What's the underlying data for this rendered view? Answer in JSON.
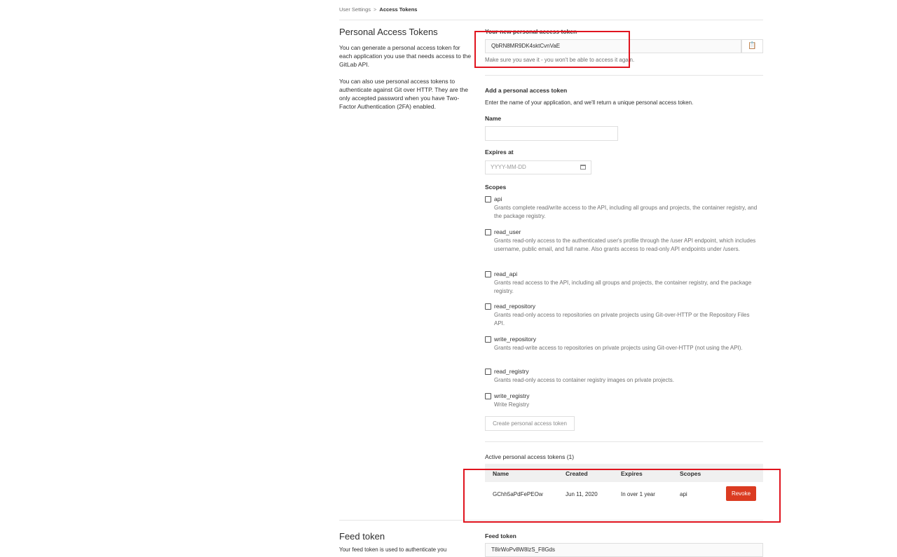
{
  "breadcrumb": {
    "parent": "User Settings",
    "separator": ">",
    "current": "Access Tokens"
  },
  "left": {
    "title": "Personal Access Tokens",
    "paragraph1": "You can generate a personal access token for each application you use that needs access to the GitLab API.",
    "paragraph2": "You can also use personal access tokens to authenticate against Git over HTTP. They are the only accepted password when you have Two-Factor Authentication (2FA) enabled."
  },
  "new_token": {
    "label": "Your new personal access token",
    "value": "QbRN8MR9DK4sktCvnVaE",
    "note": "Make sure you save it - you won't be able to access it again.",
    "copy_icon": "clipboard-icon"
  },
  "add_form": {
    "heading": "Add a personal access token",
    "intro": "Enter the name of your application, and we'll return a unique personal access token.",
    "name_label": "Name",
    "name_value": "",
    "expires_label": "Expires at",
    "expires_placeholder": "YYYY-MM-DD",
    "calendar_icon": "calendar-icon",
    "scopes_label": "Scopes",
    "scopes": [
      {
        "name": "api",
        "desc": "Grants complete read/write access to the API, including all groups and projects, the container registry, and the package registry.",
        "checked": false
      },
      {
        "name": "read_user",
        "desc": "Grants read-only access to the authenticated user's profile through the /user API endpoint, which includes username, public email, and full name. Also grants access to read-only API endpoints under /users.",
        "checked": false
      },
      {
        "name": "read_api",
        "desc": "Grants read access to the API, including all groups and projects, the container registry, and the package registry.",
        "checked": false
      },
      {
        "name": "read_repository",
        "desc": "Grants read-only access to repositories on private projects using Git-over-HTTP or the Repository Files API.",
        "checked": false
      },
      {
        "name": "write_repository",
        "desc": "Grants read-write access to repositories on private projects using Git-over-HTTP (not using the API).",
        "checked": false
      },
      {
        "name": "read_registry",
        "desc": "Grants read-only access to container registry images on private projects.",
        "checked": false
      },
      {
        "name": "write_registry",
        "desc": "Write Registry",
        "checked": false
      }
    ],
    "submit_label": "Create personal access token"
  },
  "active_tokens": {
    "heading": "Active personal access tokens (1)",
    "columns": [
      "Name",
      "Created",
      "Expires",
      "Scopes"
    ],
    "rows": [
      {
        "name": "GChh5aPdFePEOw",
        "created": "Jun 11, 2020",
        "expires": "In over 1 year",
        "scopes": "api",
        "action": "Revoke"
      }
    ]
  },
  "feed": {
    "title": "Feed token",
    "desc": "Your feed token is used to authenticate you",
    "label": "Feed token",
    "value": "T8irWoPv8W8lzS_F8Gds"
  },
  "colors": {
    "revoke": "#db3b21",
    "highlight_box": "#e0141e"
  }
}
